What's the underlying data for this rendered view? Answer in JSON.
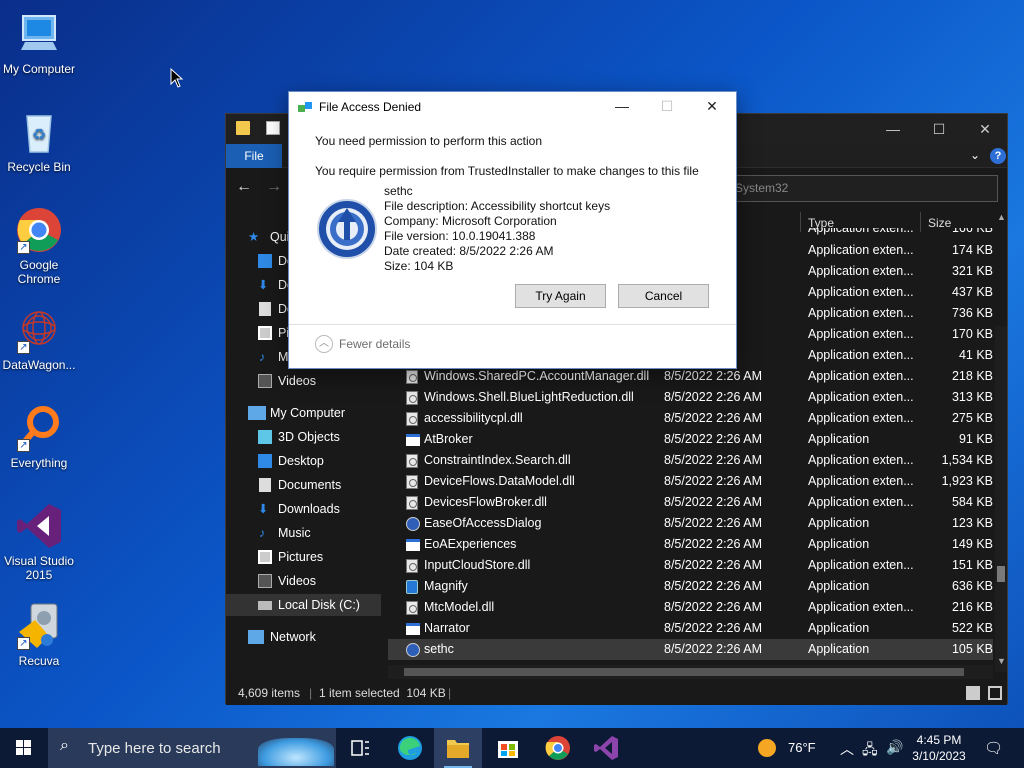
{
  "desktop": {
    "icons": [
      {
        "label": "My Computer"
      },
      {
        "label": "Recycle Bin"
      },
      {
        "label": "Google Chrome"
      },
      {
        "label": "DataWagon..."
      },
      {
        "label": "Everything"
      },
      {
        "label": "Visual Studio 2015"
      },
      {
        "label": "Recuva"
      }
    ]
  },
  "explorer": {
    "file_tab": "File",
    "address": "System32",
    "nav": {
      "quick_access": "Qui",
      "quick_items": [
        "De",
        "Do",
        "Do",
        "Pi",
        "Mu"
      ],
      "videos_top": "Videos",
      "my_computer": "My Computer",
      "pc_items": [
        "3D Objects",
        "Desktop",
        "Documents",
        "Downloads",
        "Music",
        "Pictures",
        "Videos",
        "Local Disk (C:)"
      ],
      "network": "Network"
    },
    "columns": {
      "type": "Type",
      "size": "Size"
    },
    "rows": [
      {
        "name": "",
        "date": "AM",
        "type": "Application exten...",
        "size": "174 KB"
      },
      {
        "name": "",
        "date": "AM",
        "type": "Application exten...",
        "size": "321 KB"
      },
      {
        "name": "",
        "date": "AM",
        "type": "Application exten...",
        "size": "437 KB"
      },
      {
        "name": "",
        "date": "AM",
        "type": "Application exten...",
        "size": "736 KB"
      },
      {
        "name": "",
        "date": "AM",
        "type": "Application exten...",
        "size": "170 KB"
      },
      {
        "name": "",
        "date": "AM",
        "type": "Application exten...",
        "size": "41 KB"
      },
      {
        "name": "Windows.SharedPC.AccountManager.dll",
        "date": "8/5/2022 2:26 AM",
        "type": "Application exten...",
        "size": "218 KB"
      },
      {
        "name": "Windows.Shell.BlueLightReduction.dll",
        "date": "8/5/2022 2:26 AM",
        "type": "Application exten...",
        "size": "313 KB"
      },
      {
        "name": "accessibilitycpl.dll",
        "date": "8/5/2022 2:26 AM",
        "type": "Application exten...",
        "size": "275 KB"
      },
      {
        "name": "AtBroker",
        "date": "8/5/2022 2:26 AM",
        "type": "Application",
        "size": "91 KB"
      },
      {
        "name": "ConstraintIndex.Search.dll",
        "date": "8/5/2022 2:26 AM",
        "type": "Application exten...",
        "size": "1,534 KB"
      },
      {
        "name": "DeviceFlows.DataModel.dll",
        "date": "8/5/2022 2:26 AM",
        "type": "Application exten...",
        "size": "1,923 KB"
      },
      {
        "name": "DevicesFlowBroker.dll",
        "date": "8/5/2022 2:26 AM",
        "type": "Application exten...",
        "size": "584 KB"
      },
      {
        "name": "EaseOfAccessDialog",
        "date": "8/5/2022 2:26 AM",
        "type": "Application",
        "size": "123 KB"
      },
      {
        "name": "EoAExperiences",
        "date": "8/5/2022 2:26 AM",
        "type": "Application",
        "size": "149 KB"
      },
      {
        "name": "InputCloudStore.dll",
        "date": "8/5/2022 2:26 AM",
        "type": "Application exten...",
        "size": "151 KB"
      },
      {
        "name": "Magnify",
        "date": "8/5/2022 2:26 AM",
        "type": "Application",
        "size": "636 KB"
      },
      {
        "name": "MtcModel.dll",
        "date": "8/5/2022 2:26 AM",
        "type": "Application exten...",
        "size": "216 KB"
      },
      {
        "name": "Narrator",
        "date": "8/5/2022 2:26 AM",
        "type": "Application",
        "size": "522 KB"
      },
      {
        "name": "sethc",
        "date": "8/5/2022 2:26 AM",
        "type": "Application",
        "size": "105 KB"
      }
    ],
    "partial_row": {
      "type": "Application exten...",
      "size": "166 KB"
    },
    "status": {
      "count": "4,609 items",
      "selected": "1 item selected  104 KB"
    }
  },
  "dialog": {
    "title": "File Access Denied",
    "line1": "You need permission to perform this action",
    "line2": "You require permission from TrustedInstaller to make changes to this file",
    "file_name": "sethc",
    "file_description": "File description: Accessibility shortcut keys",
    "company": "Company: Microsoft Corporation",
    "version": "File version: 10.0.19041.388",
    "date_created": "Date created: 8/5/2022 2:26 AM",
    "size": "Size: 104 KB",
    "try_again": "Try Again",
    "cancel": "Cancel",
    "fewer_details": "Fewer details"
  },
  "taskbar": {
    "search_placeholder": "Type here to search",
    "weather": "76°F",
    "time": "4:45 PM",
    "date": "3/10/2023"
  }
}
